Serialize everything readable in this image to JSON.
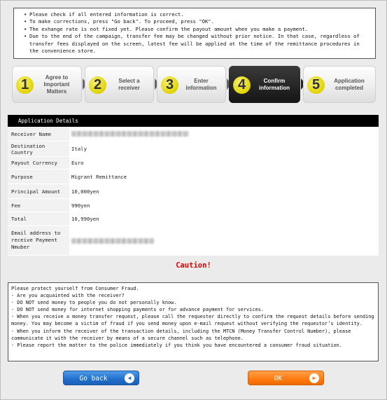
{
  "notice": [
    "Please check if all entered information is correct.",
    "To make corrections, press \"Go back\". To proceed, press \"OK\".",
    "The exhange rate is not fixed yet. Please confirm the payout amount when you make a payment.",
    "Due to the end of the campaign, transfer fee may be changed without prior notice. In that case, regardless of transfer fees displayed on the screen, latest fee will be applied at the time of the remittance procedures in the convenience store."
  ],
  "steps": [
    {
      "num": "1",
      "label": "Agree to Important Matters"
    },
    {
      "num": "2",
      "label": "Select a receiver"
    },
    {
      "num": "3",
      "label": "Enter information"
    },
    {
      "num": "4",
      "label": "Confirm information"
    },
    {
      "num": "5",
      "label": "Application completed"
    }
  ],
  "details": {
    "title": "Application Details",
    "rows": [
      {
        "key": "Receiver Name",
        "value": ""
      },
      {
        "key": "Destination Country",
        "value": "Italy"
      },
      {
        "key": "Payout Currency",
        "value": "Euro"
      },
      {
        "key": "Purpose",
        "value": "Migrant Remittance"
      },
      {
        "key": "Principal Amount",
        "value": "10,000yen"
      },
      {
        "key": "Fee",
        "value": "990yen"
      },
      {
        "key": "Total",
        "value": "10,990yen"
      },
      {
        "key": "Email address to receive Payment Nmuber",
        "value": ""
      }
    ]
  },
  "caution": "Caution!",
  "fraud": [
    "Please protect yourself from Consumer Fraud.",
    "- Are you acquainted with the receiver?",
    "- DO NOT send money to people you do not personally know.",
    "- DO NOT send money for internet shopping payments or for advance payment for services.",
    "- When you receive a money transfer request, please call the requester directly to confirm the request details before sending money. You may become a victim of fraud if you send money upon e-mail request without verifying the requestor’s identity.",
    "- When you inform the receiver of the transaction details, including the MTCN (Money Transfer Control Number), please communicate it with the receiver by means of a secure channel such as telephone.",
    "- Please report the matter to the police immediately if you think you have encountered a consumer fraud situation."
  ],
  "buttons": {
    "back": "Go back",
    "ok": "OK"
  },
  "colors": {
    "caution": "#e00000",
    "back_button": "#1f6fcc",
    "ok_button": "#ff7a10",
    "active_step": "#151515",
    "step_badge": "#e2d300"
  }
}
